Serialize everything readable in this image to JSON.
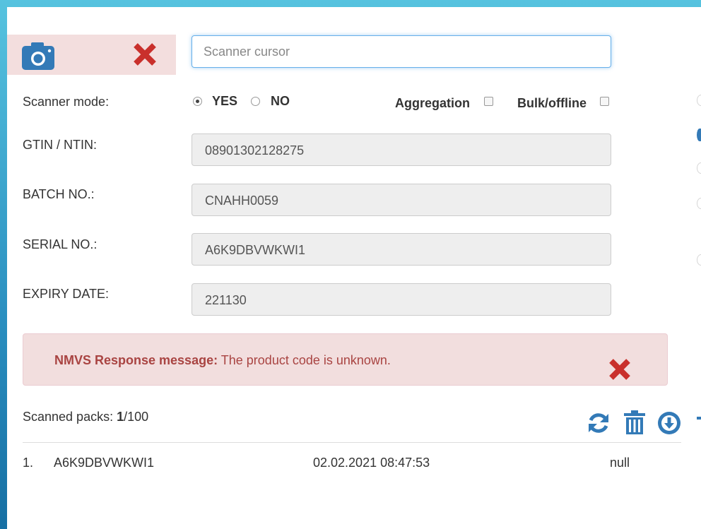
{
  "scanner": {
    "placeholder": "Scanner cursor",
    "mode_label": "Scanner mode:",
    "yes_label": "YES",
    "no_label": "NO",
    "aggregation_label": "Aggregation",
    "bulk_label": "Bulk/offline"
  },
  "fields": {
    "gtin": {
      "label": "GTIN / NTIN:",
      "value": "08901302128275"
    },
    "batch": {
      "label": "BATCH NO.:",
      "value": "CNAHH0059"
    },
    "serial": {
      "label": "SERIAL NO.:",
      "value": "A6K9DBVWKWI1"
    },
    "expiry": {
      "label": "EXPIRY DATE:",
      "value": "221130"
    }
  },
  "alert": {
    "title": "NMVS Response message:",
    "message": " The product code is unknown."
  },
  "scanned": {
    "label": "Scanned packs: ",
    "count": "1",
    "total": "/100",
    "rows": [
      {
        "index": "1.",
        "serial": "A6K9DBVWKWI1",
        "timestamp": "02.02.2021 08:47:53",
        "status": "null"
      }
    ]
  },
  "colors": {
    "accent": "#337ab7",
    "danger": "#c9302c",
    "alert_bg": "#f2dede",
    "alert_text": "#a94442",
    "bg_gradient_top": "#56c3df"
  },
  "icons": [
    "camera-icon",
    "close-icon",
    "refresh-icon",
    "trash-icon",
    "download-icon"
  ]
}
